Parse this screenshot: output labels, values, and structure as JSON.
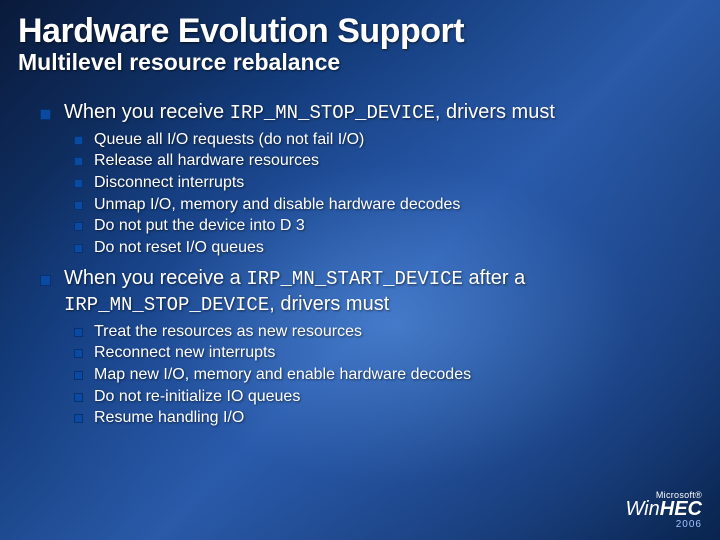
{
  "title": "Hardware Evolution Support",
  "subtitle": "Multilevel resource rebalance",
  "section1": {
    "lead_pre": "When you receive ",
    "lead_code": "IRP_MN_STOP_DEVICE",
    "lead_post": ", drivers must",
    "items": [
      "Queue all I/O requests (do not fail I/O)",
      "Release all hardware resources",
      "Disconnect interrupts",
      "Unmap I/O, memory and disable hardware decodes",
      "Do not put the device into D 3",
      "Do not reset I/O queues"
    ]
  },
  "section2": {
    "lead_pre": "When you receive a ",
    "lead_code1": "IRP_MN_START_DEVICE",
    "lead_mid": " after a ",
    "lead_code2": "IRP_MN_STOP_DEVICE",
    "lead_post": ", drivers must",
    "items": [
      "Treat the resources as new resources",
      "Reconnect new interrupts",
      "Map new I/O, memory and enable hardware decodes",
      "Do not re-initialize IO queues",
      "Resume handling I/O"
    ]
  },
  "logo": {
    "top": "Microsoft®",
    "main_thin": "Win",
    "main_bold": "HEC",
    "year": "2006"
  }
}
